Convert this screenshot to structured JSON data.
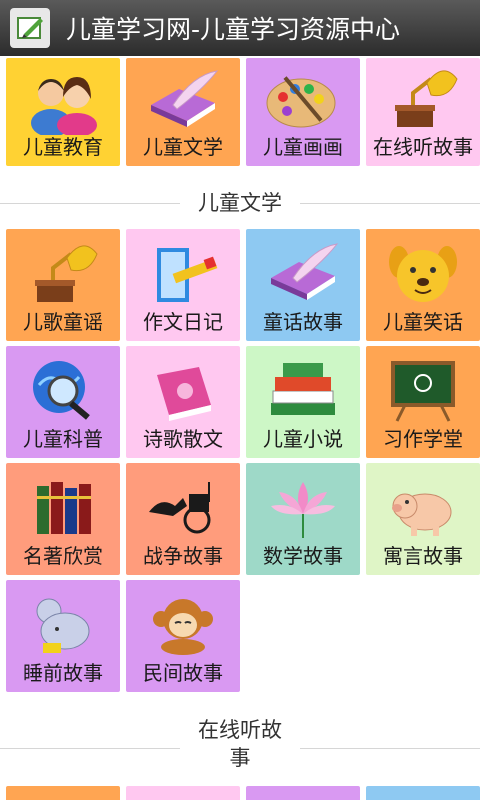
{
  "app": {
    "title": "儿童学习网-儿童学习资源中心"
  },
  "top_row": [
    {
      "label": "儿童教育",
      "icon": "parents-icon",
      "color": "#ffd233"
    },
    {
      "label": "儿童文学",
      "icon": "book-quill-icon",
      "color": "#ffa552"
    },
    {
      "label": "儿童画画",
      "icon": "palette-icon",
      "color": "#d999f2"
    },
    {
      "label": "在线听故事",
      "icon": "gramophone-icon",
      "color": "#ffc8f0"
    }
  ],
  "section_literature": {
    "title": "儿童文学",
    "items": [
      {
        "label": "儿歌童谣",
        "icon": "gramophone-icon",
        "color": "#ffa552"
      },
      {
        "label": "作文日记",
        "icon": "scroll-pencil-icon",
        "color": "#ffc8f0"
      },
      {
        "label": "童话故事",
        "icon": "book-quill-icon",
        "color": "#8ec9f2"
      },
      {
        "label": "儿童笑话",
        "icon": "dog-face-icon",
        "color": "#ffa552"
      },
      {
        "label": "儿童科普",
        "icon": "globe-magnifier-icon",
        "color": "#d999f2"
      },
      {
        "label": "诗歌散文",
        "icon": "pink-book-icon",
        "color": "#ffc8f0"
      },
      {
        "label": "儿童小说",
        "icon": "book-stack-icon",
        "color": "#cdf7c6"
      },
      {
        "label": "习作学堂",
        "icon": "chalkboard-icon",
        "color": "#ffa552"
      },
      {
        "label": "名著欣赏",
        "icon": "books-shelf-icon",
        "color": "#ff9c7c"
      },
      {
        "label": "战争故事",
        "icon": "chariot-icon",
        "color": "#ff9c7c"
      },
      {
        "label": "数学故事",
        "icon": "lotus-icon",
        "color": "#9ed9c8"
      },
      {
        "label": "寓言故事",
        "icon": "pig-icon",
        "color": "#dff5c6"
      },
      {
        "label": "睡前故事",
        "icon": "mouse-icon",
        "color": "#d999f2"
      },
      {
        "label": "民间故事",
        "icon": "monkey-icon",
        "color": "#d999f2"
      }
    ]
  },
  "section_listen": {
    "title_line1": "在线听故",
    "title_line2": "事"
  }
}
